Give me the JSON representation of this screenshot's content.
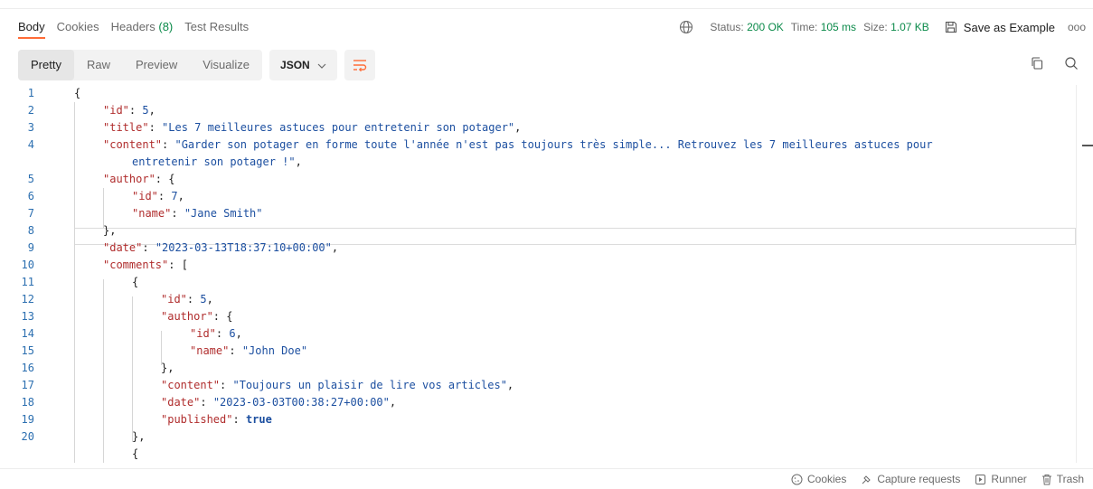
{
  "tabs": [
    {
      "label": "Body"
    },
    {
      "label": "Cookies"
    },
    {
      "label": "Headers",
      "count": "(8)"
    },
    {
      "label": "Test Results"
    }
  ],
  "status": {
    "status_label": "Status:",
    "status_value": "200 OK",
    "time_label": "Time:",
    "time_value": "105 ms",
    "size_label": "Size:",
    "size_value": "1.07 KB",
    "save_example": "Save as Example",
    "more": "ooo"
  },
  "view_modes": [
    "Pretty",
    "Raw",
    "Preview",
    "Visualize"
  ],
  "format": "JSON",
  "code_lines": [
    {
      "n": "1",
      "indent": 0,
      "parts": [
        [
          "p",
          "{"
        ]
      ]
    },
    {
      "n": "2",
      "indent": 1,
      "parts": [
        [
          "k",
          "\"id\""
        ],
        [
          "p",
          ": "
        ],
        [
          "n",
          "5"
        ],
        [
          "p",
          ","
        ]
      ]
    },
    {
      "n": "3",
      "indent": 1,
      "parts": [
        [
          "k",
          "\"title\""
        ],
        [
          "p",
          ": "
        ],
        [
          "s",
          "\"Les 7 meilleures astuces pour entretenir son potager\""
        ],
        [
          "p",
          ","
        ]
      ]
    },
    {
      "n": "4",
      "indent": 1,
      "parts": [
        [
          "k",
          "\"content\""
        ],
        [
          "p",
          ": "
        ],
        [
          "s",
          "\"Garder son potager en forme toute l'année n'est pas toujours très simple... Retrouvez les 7 meilleures astuces pour"
        ]
      ]
    },
    {
      "n": "",
      "indent": 2,
      "parts": [
        [
          "s",
          "entretenir son potager !\""
        ],
        [
          "p",
          ","
        ]
      ]
    },
    {
      "n": "5",
      "indent": 1,
      "parts": [
        [
          "k",
          "\"author\""
        ],
        [
          "p",
          ": {"
        ]
      ]
    },
    {
      "n": "6",
      "indent": 2,
      "parts": [
        [
          "k",
          "\"id\""
        ],
        [
          "p",
          ": "
        ],
        [
          "n",
          "7"
        ],
        [
          "p",
          ","
        ]
      ]
    },
    {
      "n": "7",
      "indent": 2,
      "parts": [
        [
          "k",
          "\"name\""
        ],
        [
          "p",
          ": "
        ],
        [
          "s",
          "\"Jane Smith\""
        ]
      ]
    },
    {
      "n": "8",
      "indent": 1,
      "parts": [
        [
          "p",
          "},"
        ]
      ]
    },
    {
      "n": "9",
      "indent": 1,
      "parts": [
        [
          "k",
          "\"date\""
        ],
        [
          "p",
          ": "
        ],
        [
          "s",
          "\"2023-03-13T18:37:10+00:00\""
        ],
        [
          "p",
          ","
        ]
      ]
    },
    {
      "n": "10",
      "indent": 1,
      "parts": [
        [
          "k",
          "\"comments\""
        ],
        [
          "p",
          ": ["
        ]
      ]
    },
    {
      "n": "11",
      "indent": 2,
      "parts": [
        [
          "p",
          "{"
        ]
      ]
    },
    {
      "n": "12",
      "indent": 3,
      "parts": [
        [
          "k",
          "\"id\""
        ],
        [
          "p",
          ": "
        ],
        [
          "n",
          "5"
        ],
        [
          "p",
          ","
        ]
      ]
    },
    {
      "n": "13",
      "indent": 3,
      "parts": [
        [
          "k",
          "\"author\""
        ],
        [
          "p",
          ": {"
        ]
      ]
    },
    {
      "n": "14",
      "indent": 4,
      "parts": [
        [
          "k",
          "\"id\""
        ],
        [
          "p",
          ": "
        ],
        [
          "n",
          "6"
        ],
        [
          "p",
          ","
        ]
      ]
    },
    {
      "n": "15",
      "indent": 4,
      "parts": [
        [
          "k",
          "\"name\""
        ],
        [
          "p",
          ": "
        ],
        [
          "s",
          "\"John Doe\""
        ]
      ]
    },
    {
      "n": "16",
      "indent": 3,
      "parts": [
        [
          "p",
          "},"
        ]
      ]
    },
    {
      "n": "17",
      "indent": 3,
      "parts": [
        [
          "k",
          "\"content\""
        ],
        [
          "p",
          ": "
        ],
        [
          "s",
          "\"Toujours un plaisir de lire vos articles\""
        ],
        [
          "p",
          ","
        ]
      ]
    },
    {
      "n": "18",
      "indent": 3,
      "parts": [
        [
          "k",
          "\"date\""
        ],
        [
          "p",
          ": "
        ],
        [
          "s",
          "\"2023-03-03T00:38:27+00:00\""
        ],
        [
          "p",
          ","
        ]
      ]
    },
    {
      "n": "19",
      "indent": 3,
      "parts": [
        [
          "k",
          "\"published\""
        ],
        [
          "p",
          ": "
        ],
        [
          "b",
          "true"
        ]
      ]
    },
    {
      "n": "20",
      "indent": 2,
      "parts": [
        [
          "p",
          "},"
        ]
      ]
    },
    {
      "n": "",
      "indent": 2,
      "parts": [
        [
          "p",
          "{"
        ]
      ]
    }
  ],
  "footer": {
    "cookies": "Cookies",
    "capture": "Capture requests",
    "runner": "Runner",
    "trash": "Trash"
  },
  "colors": {
    "accent": "#ff6c37",
    "success": "#0b8a4a",
    "key": "#b02d2d",
    "value": "#1c4fa0"
  }
}
